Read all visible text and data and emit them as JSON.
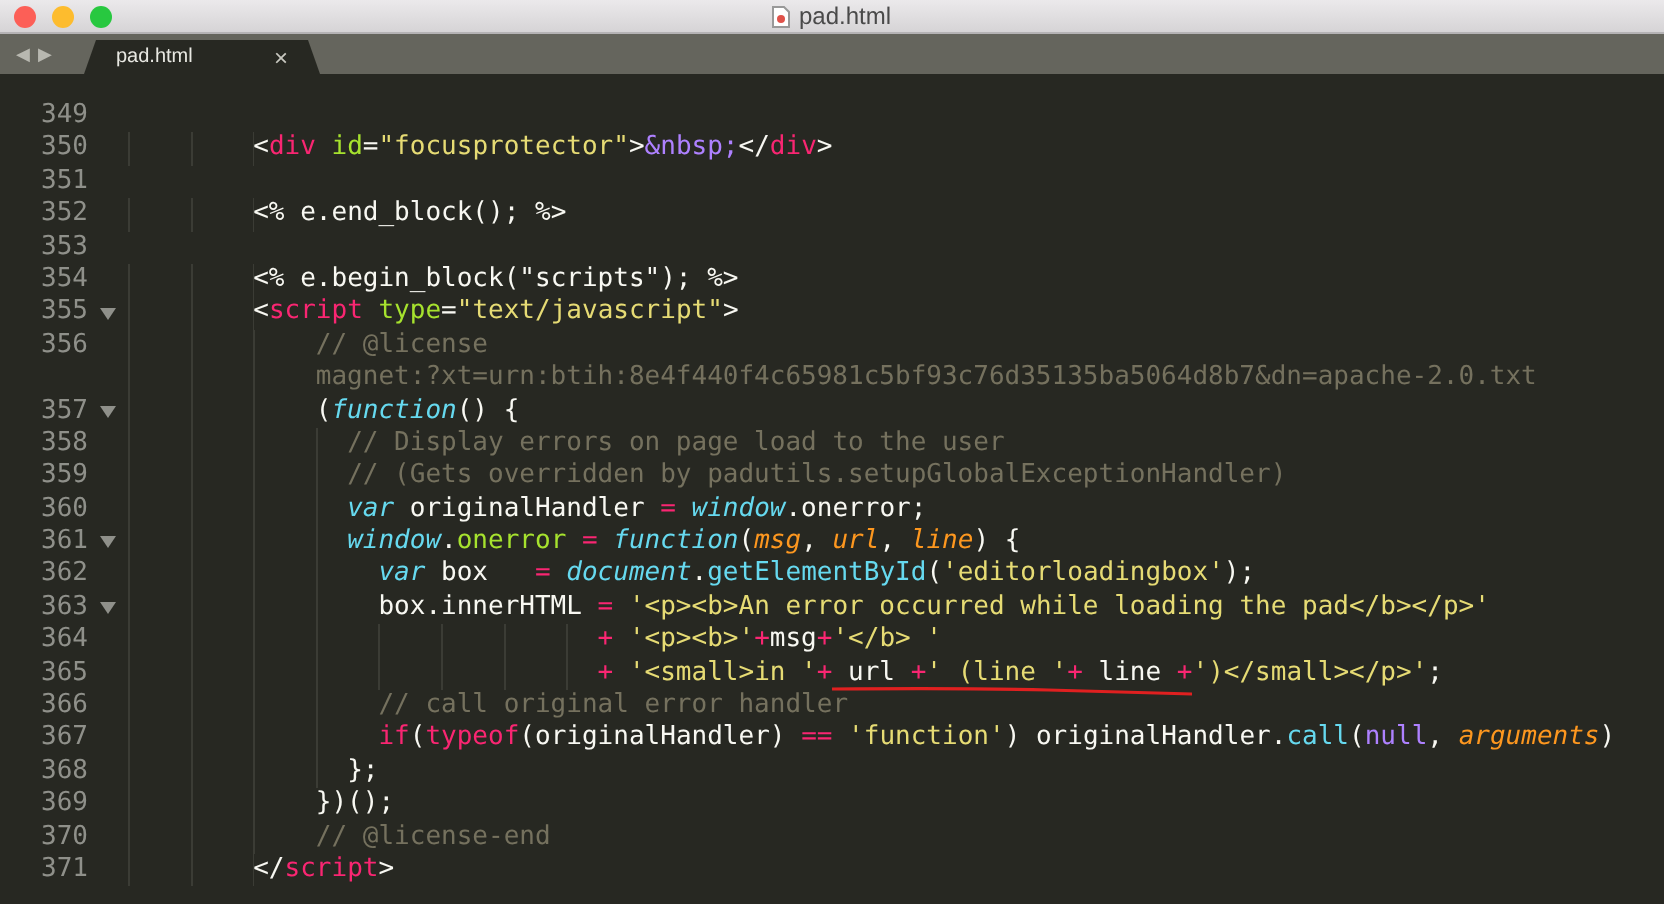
{
  "window": {
    "title": "pad.html"
  },
  "tabs": [
    {
      "label": "pad.html",
      "selected": true,
      "close": "×"
    }
  ],
  "nav": {
    "back": "◀",
    "forward": "▶"
  },
  "lines": [
    {
      "number": "349",
      "fold": false
    },
    {
      "number": "350",
      "fold": false,
      "tokens": [
        {
          "kind": "plain",
          "text": "        <"
        },
        {
          "kind": "tag",
          "text": "div"
        },
        {
          "kind": "attr",
          "text": " id"
        },
        {
          "kind": "plain",
          "text": "="
        },
        {
          "kind": "string",
          "text": "\"focusprotector\""
        },
        {
          "kind": "plain",
          "text": ">"
        },
        {
          "kind": "entity",
          "text": "&nbsp;"
        },
        {
          "kind": "plain",
          "text": "</"
        },
        {
          "kind": "tag",
          "text": "div"
        },
        {
          "kind": "plain",
          "text": ">"
        }
      ]
    },
    {
      "number": "351",
      "fold": false
    },
    {
      "number": "352",
      "fold": false,
      "tokens": [
        {
          "kind": "plain",
          "text": "        <% e.end_block(); %>"
        }
      ]
    },
    {
      "number": "353",
      "fold": false
    },
    {
      "number": "354",
      "fold": false,
      "tokens": [
        {
          "kind": "plain",
          "text": "        <% e.begin_block(\"scripts\"); %>"
        }
      ]
    },
    {
      "number": "355",
      "fold": true,
      "tokens": [
        {
          "kind": "plain",
          "text": "        <"
        },
        {
          "kind": "tag",
          "text": "script"
        },
        {
          "kind": "attr",
          "text": " type"
        },
        {
          "kind": "plain",
          "text": "="
        },
        {
          "kind": "string",
          "text": "\"text/javascript\""
        },
        {
          "kind": "plain",
          "text": ">"
        }
      ]
    },
    {
      "number": "356",
      "fold": false,
      "tokens": [
        {
          "kind": "comment",
          "text": "            // @license"
        }
      ]
    },
    {
      "fold": false,
      "tokens": [
        {
          "kind": "comment",
          "text": "            magnet:?xt=urn:btih:8e4f440f4c65981c5bf93c76d35135ba5064d8b7&dn=apache-2.0.txt"
        }
      ]
    },
    {
      "number": "357",
      "fold": true,
      "tokens": [
        {
          "kind": "plain",
          "text": "            ("
        },
        {
          "kind": "storage",
          "text": "function"
        },
        {
          "kind": "plain",
          "text": "() {"
        }
      ]
    },
    {
      "number": "358",
      "fold": false,
      "tokens": [
        {
          "kind": "comment",
          "text": "              // Display errors on page load to the user"
        }
      ]
    },
    {
      "number": "359",
      "fold": false,
      "tokens": [
        {
          "kind": "comment",
          "text": "              // (Gets overridden by padutils.setupGlobalExceptionHandler)"
        }
      ]
    },
    {
      "number": "360",
      "fold": false,
      "tokens": [
        {
          "kind": "storage",
          "text": "              var"
        },
        {
          "kind": "plain",
          "text": " originalHandler "
        },
        {
          "kind": "operator",
          "text": "="
        },
        {
          "kind": "storage",
          "text": " window"
        },
        {
          "kind": "plain",
          "text": ".onerror;"
        }
      ]
    },
    {
      "number": "361",
      "fold": true,
      "tokens": [
        {
          "kind": "storage",
          "text": "              window"
        },
        {
          "kind": "plain",
          "text": "."
        },
        {
          "kind": "name",
          "text": "onerror"
        },
        {
          "kind": "operator",
          "text": " ="
        },
        {
          "kind": "storage",
          "text": " function"
        },
        {
          "kind": "plain",
          "text": "("
        },
        {
          "kind": "param",
          "text": "msg"
        },
        {
          "kind": "plain",
          "text": ", "
        },
        {
          "kind": "param",
          "text": "url"
        },
        {
          "kind": "plain",
          "text": ", "
        },
        {
          "kind": "param",
          "text": "line"
        },
        {
          "kind": "plain",
          "text": ") {"
        }
      ]
    },
    {
      "number": "362",
      "fold": false,
      "tokens": [
        {
          "kind": "storage",
          "text": "                var"
        },
        {
          "kind": "plain",
          "text": " box   "
        },
        {
          "kind": "operator",
          "text": "="
        },
        {
          "kind": "storage",
          "text": " document"
        },
        {
          "kind": "plain",
          "text": "."
        },
        {
          "kind": "support",
          "text": "getElementById"
        },
        {
          "kind": "plain",
          "text": "("
        },
        {
          "kind": "string",
          "text": "'editorloadingbox'"
        },
        {
          "kind": "plain",
          "text": ");"
        }
      ]
    },
    {
      "number": "363",
      "fold": true,
      "tokens": [
        {
          "kind": "plain",
          "text": "                box.innerHTML "
        },
        {
          "kind": "operator",
          "text": "="
        },
        {
          "kind": "string",
          "text": " '<p><b>An error occurred while loading the pad</b></p>'"
        }
      ]
    },
    {
      "number": "364",
      "fold": false,
      "tokens": [
        {
          "kind": "operator",
          "text": "                              +"
        },
        {
          "kind": "string",
          "text": " '<p><b>'"
        },
        {
          "kind": "operator",
          "text": "+"
        },
        {
          "kind": "plain",
          "text": "msg"
        },
        {
          "kind": "operator",
          "text": "+"
        },
        {
          "kind": "string",
          "text": "'</b> '"
        }
      ]
    },
    {
      "number": "365",
      "fold": false,
      "tokens": [
        {
          "kind": "operator",
          "text": "                              +"
        },
        {
          "kind": "string",
          "text": " '<small>in '"
        },
        {
          "kind": "operator",
          "text": "+"
        },
        {
          "kind": "plain",
          "text": " url ",
          "underlined": true
        },
        {
          "kind": "operator",
          "text": "+",
          "underlined": true
        },
        {
          "kind": "string",
          "text": "' (line '",
          "underlined": true
        },
        {
          "kind": "operator",
          "text": "+",
          "underlined": true
        },
        {
          "kind": "plain",
          "text": " line ",
          "underlined": true
        },
        {
          "kind": "operator",
          "text": "+",
          "underlined": true
        },
        {
          "kind": "string",
          "text": "')</small></p>'"
        },
        {
          "kind": "plain",
          "text": ";"
        }
      ]
    },
    {
      "number": "366",
      "fold": false,
      "tokens": [
        {
          "kind": "comment",
          "text": "                // call original error handler"
        }
      ]
    },
    {
      "number": "367",
      "fold": false,
      "tokens": [
        {
          "kind": "operator",
          "text": "                if"
        },
        {
          "kind": "plain",
          "text": "("
        },
        {
          "kind": "operator",
          "text": "typeof"
        },
        {
          "kind": "plain",
          "text": "(originalHandler) "
        },
        {
          "kind": "operator",
          "text": "=="
        },
        {
          "kind": "string",
          "text": " 'function'"
        },
        {
          "kind": "plain",
          "text": ") originalHandler."
        },
        {
          "kind": "support",
          "text": "call"
        },
        {
          "kind": "plain",
          "text": "("
        },
        {
          "kind": "constant",
          "text": "null"
        },
        {
          "kind": "plain",
          "text": ", "
        },
        {
          "kind": "param",
          "text": "arguments"
        },
        {
          "kind": "plain",
          "text": ")"
        }
      ]
    },
    {
      "number": "368",
      "fold": false,
      "tokens": [
        {
          "kind": "plain",
          "text": "              };"
        }
      ]
    },
    {
      "number": "369",
      "fold": false,
      "tokens": [
        {
          "kind": "plain",
          "text": "            })();"
        }
      ]
    },
    {
      "number": "370",
      "fold": false,
      "tokens": [
        {
          "kind": "comment",
          "text": "            // @license-end"
        }
      ]
    },
    {
      "number": "371",
      "fold": false,
      "tokens": [
        {
          "kind": "plain",
          "text": "        </"
        },
        {
          "kind": "tag",
          "text": "script"
        },
        {
          "kind": "plain",
          "text": ">"
        }
      ]
    }
  ]
}
